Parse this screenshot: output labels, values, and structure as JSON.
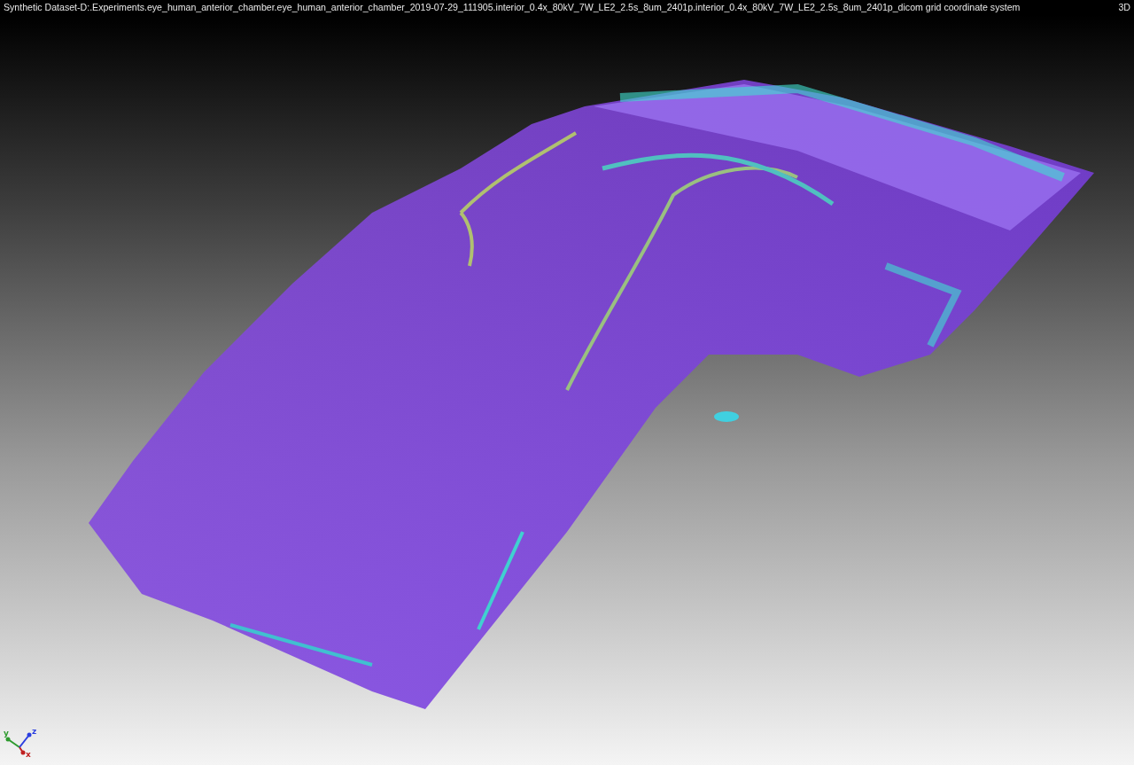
{
  "title_bar": {
    "title": "Synthetic Dataset-D:.Experiments.eye_human_anterior_chamber.eye_human_anterior_chamber_2019-07-29_111905.interior_0.4x_80kV_7W_LE2_2.5s_8um_2401p.interior_0.4x_80kV_7W_LE2_2.5s_8um_2401p_dicom grid coordinate system",
    "view_label": "3D"
  },
  "axis_triad": {
    "axes": [
      {
        "label": "y",
        "color": "#2e9a2e"
      },
      {
        "label": "z",
        "color": "#2a3ee0"
      },
      {
        "label": "x",
        "color": "#c02020"
      }
    ]
  }
}
